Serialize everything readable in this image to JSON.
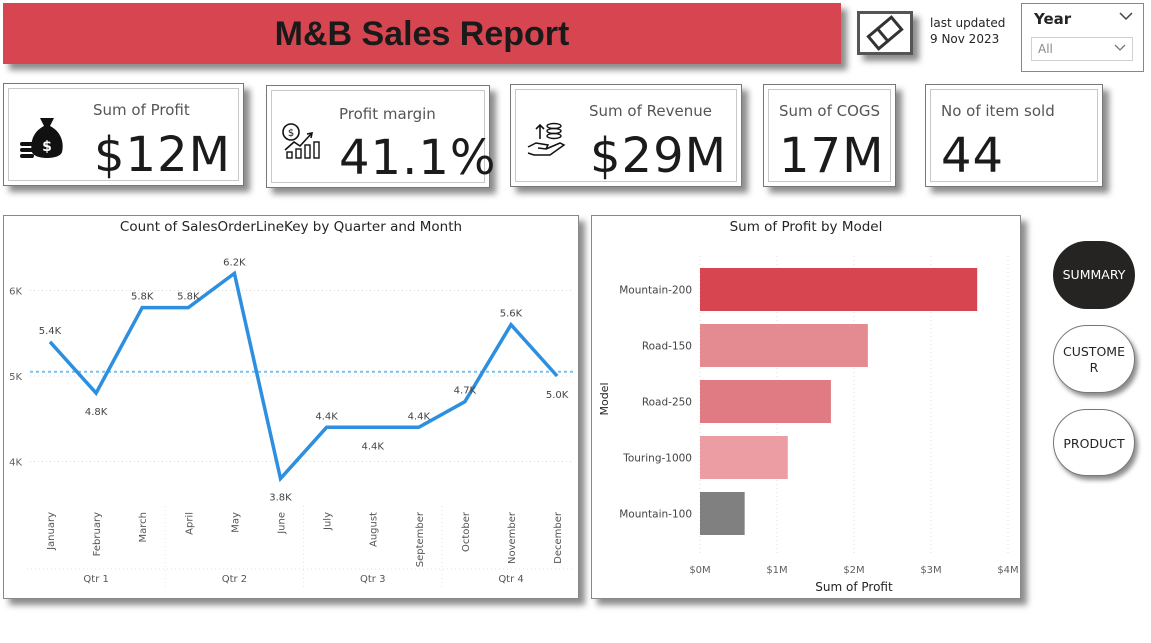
{
  "report": {
    "title": "M&B Sales Report"
  },
  "updated": {
    "line1": "last updated",
    "line2": "9 Nov 2023"
  },
  "slicer": {
    "title": "Year",
    "selected": "All"
  },
  "kpis": [
    {
      "label": "Sum of Profit",
      "value": "$12M",
      "icon": "money-bag-icon"
    },
    {
      "label": "Profit margin",
      "value": "41.1%",
      "icon": "profit-growth-chart-icon"
    },
    {
      "label": "Sum of Revenue",
      "value": "$29M",
      "icon": "hand-coins-icon"
    },
    {
      "label": "Sum of COGS",
      "value": "17M"
    },
    {
      "label": "No of item sold",
      "value": "44"
    }
  ],
  "nav": [
    {
      "label": "SUMMARY",
      "active": true
    },
    {
      "label": "CUSTOMER",
      "active": false
    },
    {
      "label": "PRODUCT",
      "active": false
    }
  ],
  "colors": {
    "banner": "#d64550",
    "line": "#2d8fdf",
    "bar_highlight": "#d64550",
    "bar_grey": "#808080"
  },
  "chart_data": [
    {
      "type": "line",
      "title": "Count of SalesOrderLineKey by Quarter and Month",
      "categories": [
        "January",
        "February",
        "March",
        "April",
        "May",
        "June",
        "July",
        "August",
        "September",
        "October",
        "November",
        "December"
      ],
      "groups": [
        {
          "label": "Qtr 1",
          "months": 3
        },
        {
          "label": "Qtr 2",
          "months": 3
        },
        {
          "label": "Qtr 3",
          "months": 3
        },
        {
          "label": "Qtr 4",
          "months": 3
        }
      ],
      "values": [
        5400,
        4800,
        5800,
        5800,
        6200,
        3800,
        4400,
        4400,
        4400,
        4700,
        5600,
        5000
      ],
      "data_labels": [
        "5.4K",
        "4.8K",
        "5.8K",
        "5.8K",
        "6.2K",
        "3.8K",
        "4.4K",
        "4.4K",
        "4.4K",
        "4.7K",
        "5.6K",
        "5.0K"
      ],
      "yticks": [
        4000,
        5000,
        6000
      ],
      "ytick_labels": [
        "4K",
        "5K",
        "6K"
      ],
      "ylim": [
        3500,
        6500
      ],
      "average_line": 5050,
      "grid": true
    },
    {
      "type": "bar",
      "orientation": "horizontal",
      "title": "Sum of Profit by Model",
      "categories": [
        "Mountain-200",
        "Road-150",
        "Road-250",
        "Touring-1000",
        "Mountain-100"
      ],
      "values": [
        3.6,
        2.18,
        1.7,
        1.14,
        0.58
      ],
      "unit": "M",
      "colors": [
        "#d64550",
        "#e48b91",
        "#e07a83",
        "#eb9da3",
        "#808080"
      ],
      "xlabel": "Sum of Profit",
      "ylabel": "Model",
      "xticks": [
        "$0M",
        "$1M",
        "$2M",
        "$3M",
        "$4M"
      ],
      "xlim": [
        0,
        4
      ],
      "grid": true
    }
  ]
}
